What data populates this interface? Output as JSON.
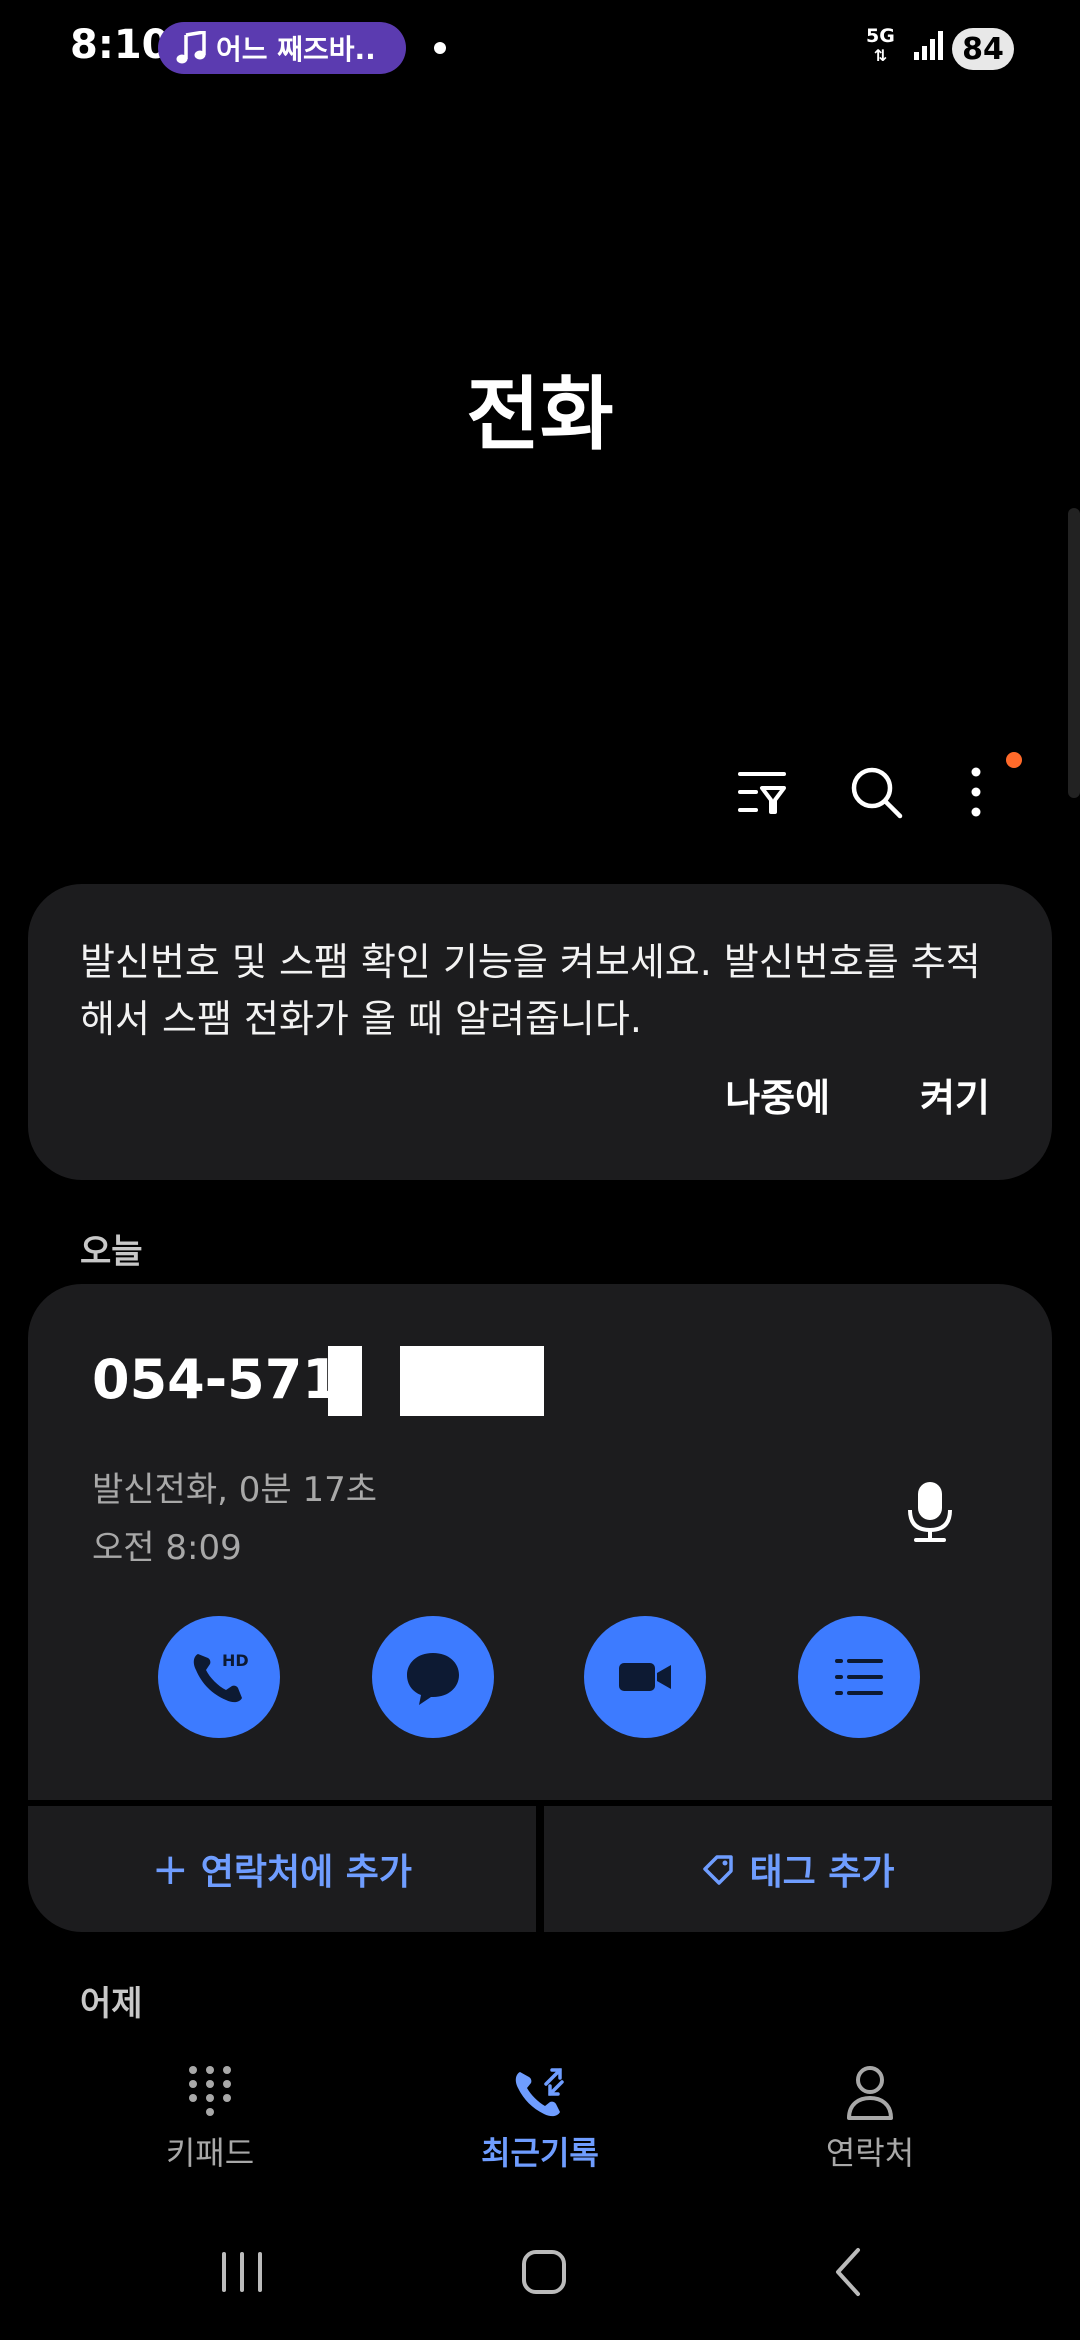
{
  "status_bar": {
    "time": "8:10",
    "media_pill": "어느 째즈바..",
    "network": "5G",
    "battery": "84"
  },
  "title": "전화",
  "toolbar": {
    "icons": [
      "filter-icon",
      "search-icon",
      "more-icon"
    ]
  },
  "banner": {
    "message": "발신번호 및 스팸 확인 기능을 켜보세요. 발신번호를 추적해서 스팸 전화가 올 때 알려줍니다.",
    "later": "나중에",
    "enable": "켜기"
  },
  "sections": {
    "today": "오늘",
    "yesterday": "어제"
  },
  "call": {
    "number": "054-571-",
    "detail": "발신전화, 0분 17초",
    "time": "오전 8:09",
    "add_contact": "연락처에 추가",
    "add_tag": "태그 추가"
  },
  "bottom_nav": {
    "keypad": "키패드",
    "recents": "최근기록",
    "contacts": "연락처"
  },
  "colors": {
    "accent": "#3d7bff",
    "accent_text": "#6f9dff",
    "card": "#1c1c1e",
    "notification": "#ff6a2a",
    "media_pill": "#5b3bb0"
  }
}
